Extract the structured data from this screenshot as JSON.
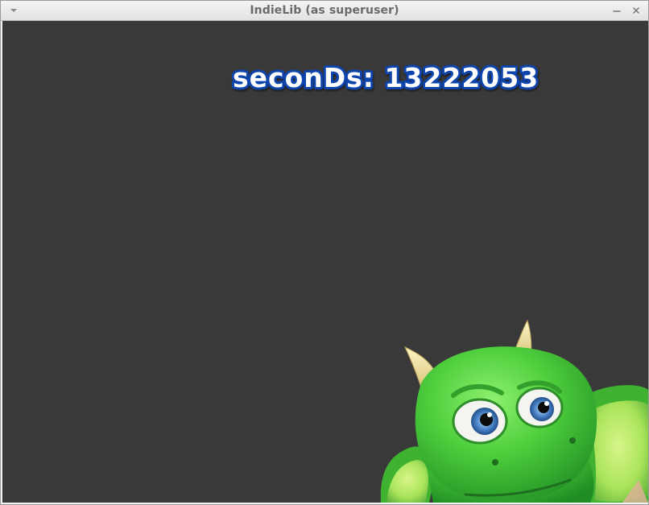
{
  "window": {
    "title": "IndieLib (as superuser)",
    "menu_icon": "chevron-down-icon",
    "minimize_icon": "minimize-icon",
    "close_icon": "close-icon"
  },
  "hud": {
    "seconds_label": "seconDs: 13222053"
  },
  "colors": {
    "background": "#393939",
    "hud_text": "#ffffff",
    "hud_outline": "#0d45ac",
    "dragon_green": "#4fcf3d"
  }
}
